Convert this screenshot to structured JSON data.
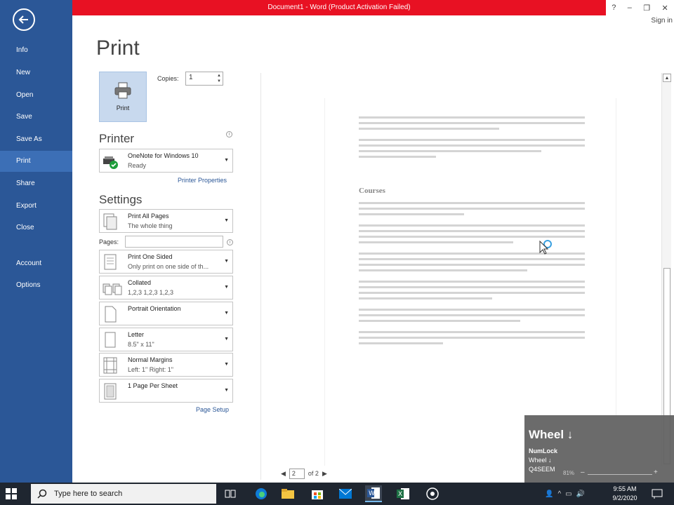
{
  "window": {
    "title": "Document1 - Word (Product Activation Failed)",
    "controls": {
      "help": "?",
      "minimize": "–",
      "restore": "❐",
      "close": "✕"
    },
    "sign_in": "Sign in"
  },
  "sidebar": {
    "items": [
      {
        "label": "Info"
      },
      {
        "label": "New"
      },
      {
        "label": "Open"
      },
      {
        "label": "Save"
      },
      {
        "label": "Save As"
      },
      {
        "label": "Print"
      },
      {
        "label": "Share"
      },
      {
        "label": "Export"
      },
      {
        "label": "Close"
      },
      {
        "label": "Account"
      },
      {
        "label": "Options"
      }
    ],
    "active": "Print"
  },
  "print": {
    "heading": "Print",
    "button_label": "Print",
    "copies_label": "Copies:",
    "copies_value": "1"
  },
  "printer": {
    "title": "Printer",
    "name": "OneNote for Windows 10",
    "status": "Ready",
    "properties_link": "Printer Properties"
  },
  "settings": {
    "title": "Settings",
    "pages_label": "Pages:",
    "pages_value": "",
    "dropdowns": [
      {
        "line1": "Print All Pages",
        "line2": "The whole thing"
      },
      {
        "line1": "Print One Sided",
        "line2": "Only print on one side of th..."
      },
      {
        "line1": "Collated",
        "line2": "1,2,3    1,2,3    1,2,3"
      },
      {
        "line1": "Portrait Orientation",
        "line2": ""
      },
      {
        "line1": "Letter",
        "line2": "8.5\" x 11\""
      },
      {
        "line1": "Normal Margins",
        "line2": "Left:  1\"    Right:  1\""
      },
      {
        "line1": "1 Page Per Sheet",
        "line2": ""
      }
    ],
    "page_setup_link": "Page Setup"
  },
  "preview": {
    "heading": "Courses",
    "current_page": "2",
    "of_pages": "of 2"
  },
  "key_overlay": {
    "main": "Wheel ↓",
    "line1": "NumLock",
    "line2": "Wheel ↓",
    "line3": "Q4SEEM",
    "zoom": "81%"
  },
  "taskbar": {
    "search_placeholder": "Type here to search",
    "time": "9:55 AM",
    "date": "9/2/2020"
  },
  "colors": {
    "sidebar": "#2b5797",
    "titlebar": "#e81123",
    "taskbar": "#1f2630"
  }
}
